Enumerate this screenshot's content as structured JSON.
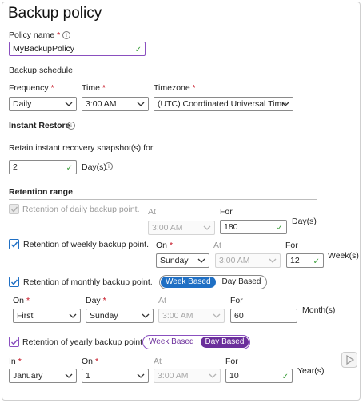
{
  "title": "Backup policy",
  "policy_name": {
    "label": "Policy name",
    "required_mark": "*",
    "value": "MyBackupPolicy"
  },
  "backup_schedule": {
    "heading": "Backup schedule",
    "frequency": {
      "label": "Frequency",
      "value": "Daily"
    },
    "time": {
      "label": "Time",
      "value": "3:00 AM"
    },
    "timezone": {
      "label": "Timezone",
      "value": "(UTC) Coordinated Universal Time"
    }
  },
  "instant_restore": {
    "heading": "Instant Restore",
    "retain_label": "Retain instant recovery snapshot(s) for",
    "value": "2",
    "unit": "Day(s)"
  },
  "retention_range": {
    "heading": "Retention range",
    "daily": {
      "label": "Retention of daily backup point.",
      "at_label": "At",
      "at_value": "3:00 AM",
      "for_label": "For",
      "for_value": "180",
      "unit": "Day(s)"
    },
    "weekly": {
      "label": "Retention of weekly backup point.",
      "on_label": "On",
      "on_value": "Sunday",
      "at_label": "At",
      "at_value": "3:00 AM",
      "for_label": "For",
      "for_value": "12",
      "unit": "Week(s)"
    },
    "monthly": {
      "label": "Retention of monthly backup point.",
      "toggle": [
        "Week Based",
        "Day Based"
      ],
      "on_label": "On",
      "on_value": "First",
      "day_label": "Day",
      "day_value": "Sunday",
      "at_label": "At",
      "at_value": "3:00 AM",
      "for_label": "For",
      "for_value": "60",
      "unit": "Month(s)"
    },
    "yearly": {
      "label": "Retention of yearly backup point.",
      "toggle": [
        "Week Based",
        "Day Based"
      ],
      "in_label": "In",
      "in_value": "January",
      "on_label": "On",
      "on_value": "1",
      "at_label": "At",
      "at_value": "3:00 AM",
      "for_label": "For",
      "for_value": "10",
      "unit": "Year(s)"
    }
  },
  "icons": {
    "info": "info-icon",
    "chevron": "chevron-down-icon",
    "check": "checkmark-icon",
    "play": "play-icon"
  },
  "colors": {
    "accent_blue": "#1f6fc4",
    "accent_purple": "#6b2f9b",
    "required": "#c50f1f",
    "valid": "#3a9d3a"
  }
}
